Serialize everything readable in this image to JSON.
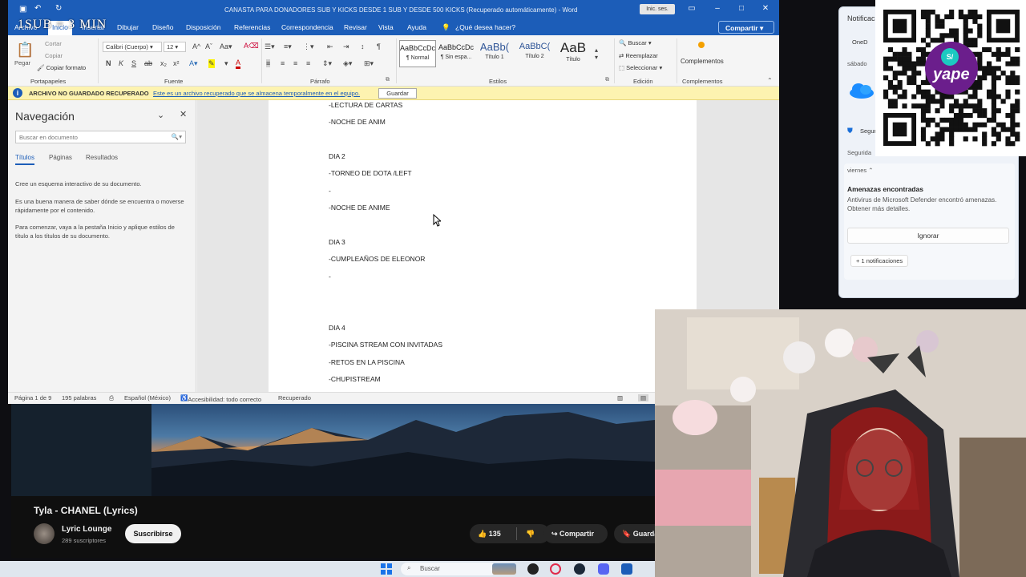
{
  "word": {
    "doc_title": "CANASTA PARA DONADORES SUB Y KICKS DESDE 1 SUB Y DESDE 500 KICKS (Recuperado automáticamente) - Word",
    "signin": "Inic. ses.",
    "overlay_text": "1SUB = 3 MIN",
    "menu": [
      "Archivo",
      "Inicio",
      "Insertar",
      "Dibujar",
      "Diseño",
      "Disposición",
      "Referencias",
      "Correspondencia",
      "Revisar",
      "Vista",
      "Ayuda"
    ],
    "search_tell": "¿Qué desea hacer?",
    "share": "Compartir",
    "ribbon": {
      "clipboard": {
        "paste": "Pegar",
        "cut": "Cortar",
        "copy": "Copiar",
        "format": "Copiar formato",
        "label": "Portapapeles"
      },
      "font": {
        "name": "Calibri (Cuerpo)",
        "size": "12",
        "label": "Fuente"
      },
      "paragraph": {
        "label": "Párrafo"
      },
      "styles": {
        "label": "Estilos",
        "items": [
          {
            "sample": "AaBbCcDc",
            "name": "¶ Normal"
          },
          {
            "sample": "AaBbCcDc",
            "name": "¶ Sin espa..."
          },
          {
            "sample": "AaBb(",
            "name": "Título 1"
          },
          {
            "sample": "AaBbC(",
            "name": "Título 2"
          },
          {
            "sample": "AaB",
            "name": "Título"
          }
        ]
      },
      "editing": {
        "find": "Buscar",
        "replace": "Reemplazar",
        "select": "Seleccionar",
        "label": "Edición"
      },
      "addins": {
        "name": "Complementos",
        "label": "Complementos"
      }
    },
    "infobar": {
      "title": "ARCHIVO NO GUARDADO RECUPERADO",
      "link": "Este es un archivo recuperado que se almacena temporalmente en el equipo.",
      "button": "Guardar"
    },
    "nav": {
      "title": "Navegación",
      "search_placeholder": "Buscar en documento",
      "tabs": [
        "Títulos",
        "Páginas",
        "Resultados"
      ],
      "paragraphs": [
        "Cree un esquema interactivo de su documento.",
        "Es una buena manera de saber dónde se encuentra o moverse rápidamente por el contenido.",
        "Para comenzar, vaya a la pestaña Inicio y aplique estilos de título a los títulos de su documento."
      ]
    },
    "doc_lines": [
      "-LECTURA DE CARTAS",
      "-NOCHE DE ANIM",
      "DIA 2",
      "-TORNEO DE DOTA /LEFT",
      "-",
      "-NOCHE DE ANIME",
      "DIA 3",
      "-CUMPLEAÑOS DE ELEONOR",
      "-",
      "DIA 4",
      "-PISCINA STREAM CON INVITADAS",
      "-RETOS EN LA PISCINA",
      "-CHUPISTREAM"
    ],
    "status": {
      "page": "Página 1 de 9",
      "words": "195 palabras",
      "lang": "Español (México)",
      "access": "Accesibilidad: todo correcto",
      "recovered": "Recuperado"
    }
  },
  "youtube": {
    "title": "Tyla - CHANEL (Lyrics)",
    "channel": "Lyric Lounge",
    "subs": "289 suscriptores",
    "subscribe": "Suscribirse",
    "likes": "135",
    "share": "Compartir",
    "save": "Guardar"
  },
  "taskbar": {
    "search": "Buscar"
  },
  "notifications": {
    "header": "Notificaci",
    "onedrive": "OneD",
    "day1": "sábado",
    "security_app": "Segur",
    "security_header": "Segurida",
    "day2": "viernes",
    "threat_title": "Amenazas encontradas",
    "threat_body": "Antivirus de Microsoft Defender encontró amenazas. Obtener más detalles.",
    "ignore": "Ignorar",
    "more": "+ 1 notificaciones"
  },
  "qr": {
    "brand": "yape",
    "badge": "S/"
  }
}
